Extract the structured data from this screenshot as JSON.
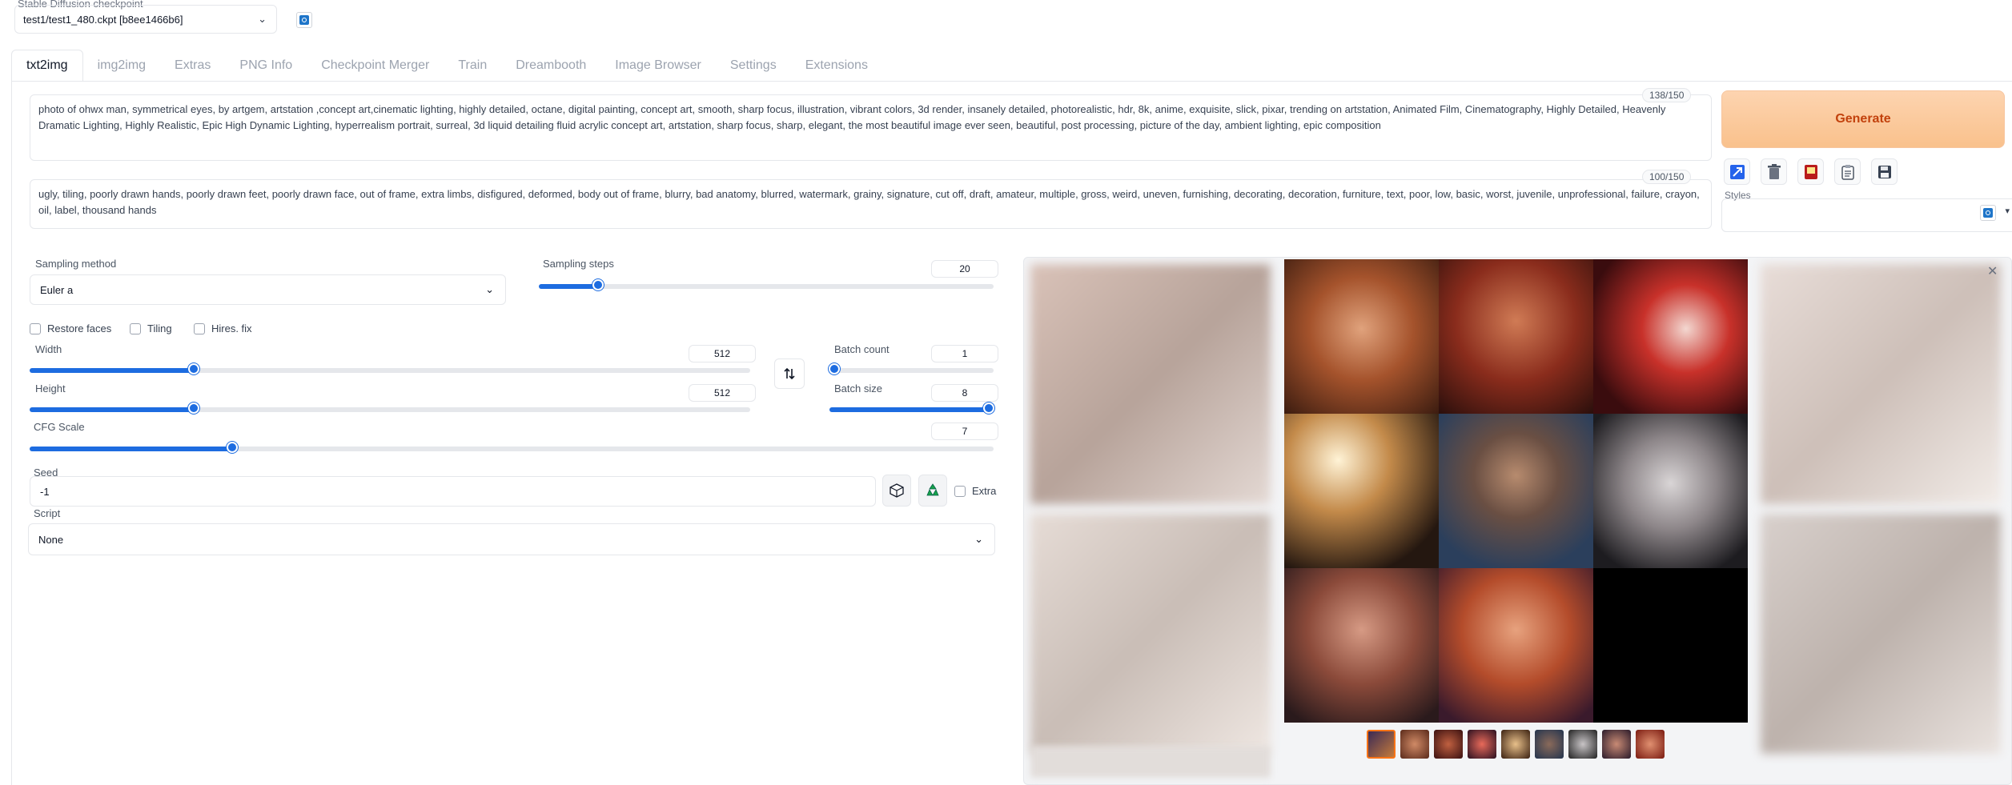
{
  "checkpoint": {
    "label": "Stable Diffusion checkpoint",
    "value": "test1/test1_480.ckpt [b8ee1466b6]"
  },
  "tabs": [
    {
      "label": "txt2img",
      "active": true
    },
    {
      "label": "img2img"
    },
    {
      "label": "Extras"
    },
    {
      "label": "PNG Info"
    },
    {
      "label": "Checkpoint Merger"
    },
    {
      "label": "Train"
    },
    {
      "label": "Dreambooth"
    },
    {
      "label": "Image Browser"
    },
    {
      "label": "Settings"
    },
    {
      "label": "Extensions"
    }
  ],
  "prompt": {
    "text": "photo of ohwx man, symmetrical eyes, by artgem, artstation ,concept art,cinematic lighting, highly detailed, octane, digital painting, concept art, smooth, sharp focus, illustration, vibrant colors, 3d render, insanely detailed, photorealistic, hdr, 8k, anime, exquisite, slick, pixar, trending on artstation, Animated Film, Cinematography, Highly Detailed, Heavenly Dramatic Lighting, Highly Realistic, Epic High Dynamic Lighting, hyperrealism portrait, surreal, 3d liquid detailing fluid acrylic concept art, artstation, sharp focus, sharp, elegant, the most beautiful image ever seen, beautiful, post processing, picture of the day, ambient lighting, epic composition",
    "counter": "138/150"
  },
  "negative_prompt": {
    "text": "ugly, tiling, poorly drawn hands, poorly drawn feet, poorly drawn face, out of frame, extra limbs, disfigured, deformed, body out of frame, blurry, bad anatomy, blurred, watermark, grainy, signature, cut off, draft, amateur, multiple, gross, weird, uneven, furnishing, decorating, decoration, furniture, text, poor, low, basic, worst, juvenile, unprofessional, failure, crayon, oil, label, thousand hands",
    "counter": "100/150"
  },
  "generate_label": "Generate",
  "styles_label": "Styles",
  "sampling": {
    "method_label": "Sampling method",
    "method_value": "Euler a",
    "steps_label": "Sampling steps",
    "steps_value": "20",
    "steps_fraction": 0.13
  },
  "checkboxes": {
    "restore_faces": "Restore faces",
    "tiling": "Tiling",
    "hires_fix": "Hires. fix",
    "extra": "Extra"
  },
  "width": {
    "label": "Width",
    "value": "512",
    "fraction": 0.228
  },
  "height": {
    "label": "Height",
    "value": "512",
    "fraction": 0.228
  },
  "batch_count": {
    "label": "Batch count",
    "value": "1",
    "fraction": 0.0
  },
  "batch_size": {
    "label": "Batch size",
    "value": "8",
    "fraction": 1.0
  },
  "cfg": {
    "label": "CFG Scale",
    "value": "7",
    "fraction": 0.21
  },
  "seed": {
    "label": "Seed",
    "value": "-1"
  },
  "script": {
    "label": "Script",
    "value": "None"
  },
  "icons": {
    "swap": "swap-dimensions-icon",
    "dice": "random-seed-dice-icon",
    "recycle": "reuse-seed-recycle-icon",
    "close": "close-icon"
  },
  "accent_color": "#1d6ce0",
  "generate_color": "#f9c18c"
}
